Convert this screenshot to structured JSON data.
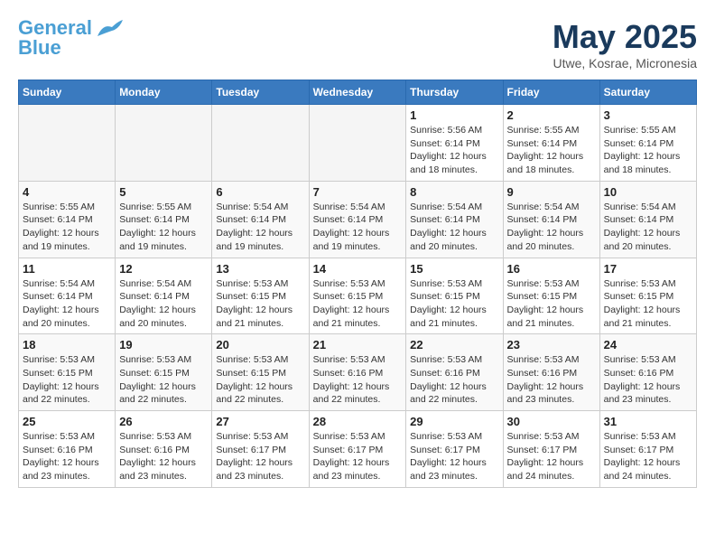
{
  "logo": {
    "line1": "General",
    "line2": "Blue"
  },
  "title": "May 2025",
  "location": "Utwe, Kosrae, Micronesia",
  "weekdays": [
    "Sunday",
    "Monday",
    "Tuesday",
    "Wednesday",
    "Thursday",
    "Friday",
    "Saturday"
  ],
  "weeks": [
    [
      {
        "day": "",
        "info": ""
      },
      {
        "day": "",
        "info": ""
      },
      {
        "day": "",
        "info": ""
      },
      {
        "day": "",
        "info": ""
      },
      {
        "day": "1",
        "info": "Sunrise: 5:56 AM\nSunset: 6:14 PM\nDaylight: 12 hours\nand 18 minutes."
      },
      {
        "day": "2",
        "info": "Sunrise: 5:55 AM\nSunset: 6:14 PM\nDaylight: 12 hours\nand 18 minutes."
      },
      {
        "day": "3",
        "info": "Sunrise: 5:55 AM\nSunset: 6:14 PM\nDaylight: 12 hours\nand 18 minutes."
      }
    ],
    [
      {
        "day": "4",
        "info": "Sunrise: 5:55 AM\nSunset: 6:14 PM\nDaylight: 12 hours\nand 19 minutes."
      },
      {
        "day": "5",
        "info": "Sunrise: 5:55 AM\nSunset: 6:14 PM\nDaylight: 12 hours\nand 19 minutes."
      },
      {
        "day": "6",
        "info": "Sunrise: 5:54 AM\nSunset: 6:14 PM\nDaylight: 12 hours\nand 19 minutes."
      },
      {
        "day": "7",
        "info": "Sunrise: 5:54 AM\nSunset: 6:14 PM\nDaylight: 12 hours\nand 19 minutes."
      },
      {
        "day": "8",
        "info": "Sunrise: 5:54 AM\nSunset: 6:14 PM\nDaylight: 12 hours\nand 20 minutes."
      },
      {
        "day": "9",
        "info": "Sunrise: 5:54 AM\nSunset: 6:14 PM\nDaylight: 12 hours\nand 20 minutes."
      },
      {
        "day": "10",
        "info": "Sunrise: 5:54 AM\nSunset: 6:14 PM\nDaylight: 12 hours\nand 20 minutes."
      }
    ],
    [
      {
        "day": "11",
        "info": "Sunrise: 5:54 AM\nSunset: 6:14 PM\nDaylight: 12 hours\nand 20 minutes."
      },
      {
        "day": "12",
        "info": "Sunrise: 5:54 AM\nSunset: 6:14 PM\nDaylight: 12 hours\nand 20 minutes."
      },
      {
        "day": "13",
        "info": "Sunrise: 5:53 AM\nSunset: 6:15 PM\nDaylight: 12 hours\nand 21 minutes."
      },
      {
        "day": "14",
        "info": "Sunrise: 5:53 AM\nSunset: 6:15 PM\nDaylight: 12 hours\nand 21 minutes."
      },
      {
        "day": "15",
        "info": "Sunrise: 5:53 AM\nSunset: 6:15 PM\nDaylight: 12 hours\nand 21 minutes."
      },
      {
        "day": "16",
        "info": "Sunrise: 5:53 AM\nSunset: 6:15 PM\nDaylight: 12 hours\nand 21 minutes."
      },
      {
        "day": "17",
        "info": "Sunrise: 5:53 AM\nSunset: 6:15 PM\nDaylight: 12 hours\nand 21 minutes."
      }
    ],
    [
      {
        "day": "18",
        "info": "Sunrise: 5:53 AM\nSunset: 6:15 PM\nDaylight: 12 hours\nand 22 minutes."
      },
      {
        "day": "19",
        "info": "Sunrise: 5:53 AM\nSunset: 6:15 PM\nDaylight: 12 hours\nand 22 minutes."
      },
      {
        "day": "20",
        "info": "Sunrise: 5:53 AM\nSunset: 6:15 PM\nDaylight: 12 hours\nand 22 minutes."
      },
      {
        "day": "21",
        "info": "Sunrise: 5:53 AM\nSunset: 6:16 PM\nDaylight: 12 hours\nand 22 minutes."
      },
      {
        "day": "22",
        "info": "Sunrise: 5:53 AM\nSunset: 6:16 PM\nDaylight: 12 hours\nand 22 minutes."
      },
      {
        "day": "23",
        "info": "Sunrise: 5:53 AM\nSunset: 6:16 PM\nDaylight: 12 hours\nand 23 minutes."
      },
      {
        "day": "24",
        "info": "Sunrise: 5:53 AM\nSunset: 6:16 PM\nDaylight: 12 hours\nand 23 minutes."
      }
    ],
    [
      {
        "day": "25",
        "info": "Sunrise: 5:53 AM\nSunset: 6:16 PM\nDaylight: 12 hours\nand 23 minutes."
      },
      {
        "day": "26",
        "info": "Sunrise: 5:53 AM\nSunset: 6:16 PM\nDaylight: 12 hours\nand 23 minutes."
      },
      {
        "day": "27",
        "info": "Sunrise: 5:53 AM\nSunset: 6:17 PM\nDaylight: 12 hours\nand 23 minutes."
      },
      {
        "day": "28",
        "info": "Sunrise: 5:53 AM\nSunset: 6:17 PM\nDaylight: 12 hours\nand 23 minutes."
      },
      {
        "day": "29",
        "info": "Sunrise: 5:53 AM\nSunset: 6:17 PM\nDaylight: 12 hours\nand 23 minutes."
      },
      {
        "day": "30",
        "info": "Sunrise: 5:53 AM\nSunset: 6:17 PM\nDaylight: 12 hours\nand 24 minutes."
      },
      {
        "day": "31",
        "info": "Sunrise: 5:53 AM\nSunset: 6:17 PM\nDaylight: 12 hours\nand 24 minutes."
      }
    ]
  ]
}
